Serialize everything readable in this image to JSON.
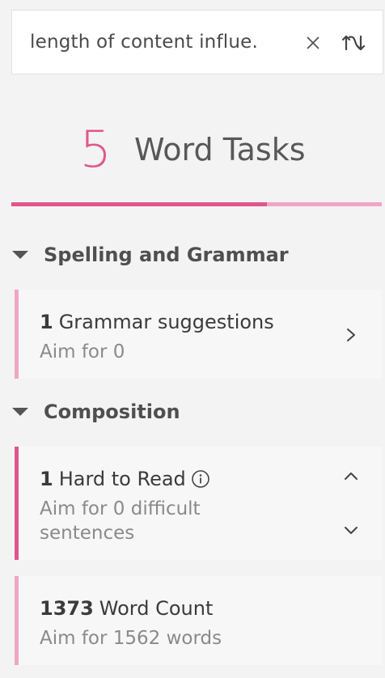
{
  "search": {
    "value": "length of content influe.",
    "clear_icon": "close-icon",
    "swap_icon": "swap-icon"
  },
  "tasks": {
    "count": "5",
    "label": "Word Tasks",
    "progress_fraction": 0.69
  },
  "colors": {
    "accent": "#e0558d",
    "accent_light": "#f0a6c3"
  },
  "sections": [
    {
      "title": "Spelling and Grammar",
      "cards": [
        {
          "number": "1",
          "label": "Grammar suggestions",
          "sub": "Aim for 0"
        }
      ]
    },
    {
      "title": "Composition",
      "cards": [
        {
          "number": "1",
          "label": "Hard to Read",
          "sub_line1": "Aim for 0 difficult",
          "sub_line2": "sentences"
        },
        {
          "number": "1373",
          "label": "Word Count",
          "sub": "Aim for 1562 words"
        }
      ]
    }
  ]
}
